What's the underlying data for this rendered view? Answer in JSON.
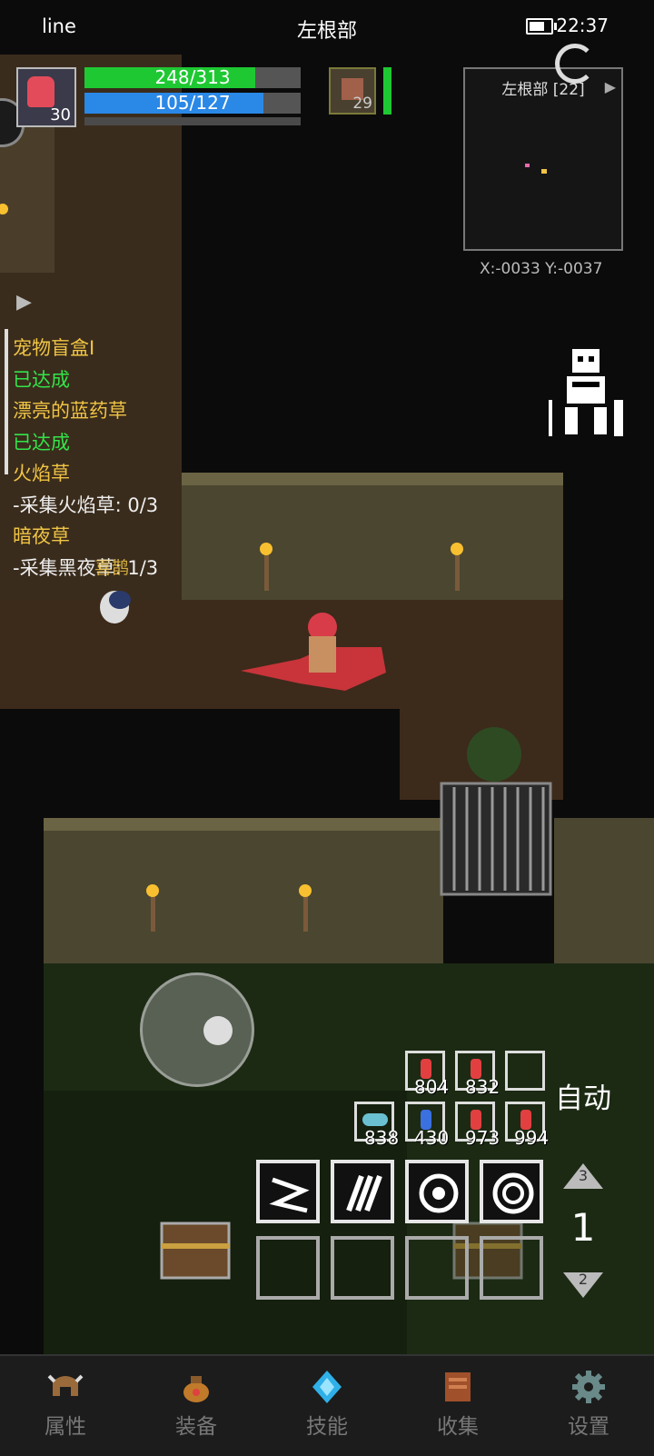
{
  "status_bar": {
    "carrier": "line",
    "title": "左根部",
    "time": "22:37"
  },
  "player": {
    "level": "30",
    "hp_text": "248/313",
    "mp_text": "105/127",
    "hp_fraction": 0.792,
    "mp_fraction": 0.827
  },
  "pet": {
    "level": "29",
    "hp_fraction": 1.0
  },
  "minimap": {
    "name": "左根部 [22]",
    "coords": "X:-0033  Y:-0037"
  },
  "quests": [
    {
      "title": "宠物盲盒I",
      "status": "已达成"
    },
    {
      "title": "漂亮的蓝药草",
      "status": "已达成"
    },
    {
      "title": "火焰草",
      "status": "-采集火焰草: 0/3"
    },
    {
      "title": "暗夜草",
      "status": "-采集黑夜草: 1/3"
    }
  ],
  "npc_label": "喜鹊",
  "items": {
    "row1": [
      "804",
      "832"
    ],
    "row2": [
      "838",
      "430",
      "973",
      "994"
    ]
  },
  "auto_label": "自动",
  "page": {
    "up": "3",
    "current": "1",
    "down": "2"
  },
  "nav": [
    "属性",
    "装备",
    "技能",
    "收集",
    "设置"
  ],
  "colors": {
    "hp": "#1ec832",
    "mp": "#2a88e6",
    "quest_title": "#f0c445",
    "quest_done": "#34e34a"
  }
}
